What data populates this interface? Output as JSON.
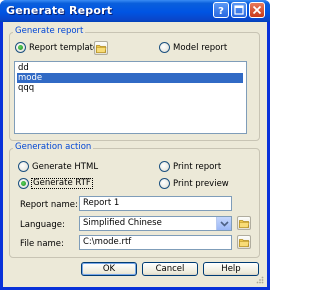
{
  "window": {
    "title": "Generate Report"
  },
  "generate_report": {
    "group_label": "Generate report",
    "report_template_label": "Report template",
    "report_template_checked": true,
    "model_report_label": "Model report",
    "model_report_checked": false,
    "templates": [
      {
        "label": "dd",
        "selected": false
      },
      {
        "label": "mode",
        "selected": true
      },
      {
        "label": "qqq",
        "selected": false
      }
    ]
  },
  "generation_action": {
    "group_label": "Generation action",
    "generate_html_label": "Generate HTML",
    "generate_rtf_label": "Generate RTF",
    "print_report_label": "Print report",
    "print_preview_label": "Print preview",
    "selected": "Generate RTF",
    "report_name_label": "Report name:",
    "report_name_value": "Report 1",
    "language_label": "Language:",
    "language_value": "Simplified Chinese",
    "file_name_label": "File name:",
    "file_name_value": "C:\\mode.rtf"
  },
  "buttons": {
    "ok": "OK",
    "cancel": "Cancel",
    "help": "Help"
  },
  "icons": {
    "help": "help-icon",
    "maximize": "maximize-icon",
    "close": "close-icon",
    "folder": "folder-icon",
    "dropdown": "chevron-down-icon"
  }
}
